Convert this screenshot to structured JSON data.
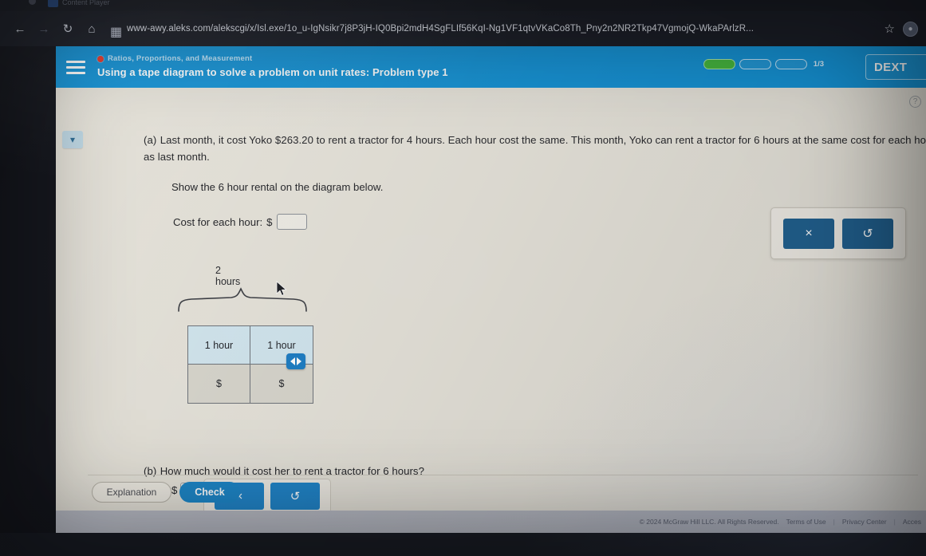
{
  "browser": {
    "tab_title": "Content Player",
    "url": "www-awy.aleks.com/alekscgi/x/Isl.exe/1o_u-IgNsikr7j8P3jH-IQ0Bpi2mdH4SgFLIf56KqI-Ng1VF1qtvVKaCo8Th_Pny2n2NR2Tkp47VgmojQ-WkaPArlzR...",
    "back_icon": "back-arrow-icon",
    "forward_icon": "forward-arrow-icon",
    "reload_icon": "reload-icon",
    "home_icon": "home-icon",
    "site_icon": "site-info-icon",
    "bookmark_icon": "star-icon",
    "profile_icon": "profile-avatar-icon"
  },
  "header": {
    "menu_icon": "hamburger-menu-icon",
    "eyebrow": "Ratios, Proportions, and Measurement",
    "title": "Using a tape diagram to solve a problem on unit rates: Problem type 1",
    "progress_segments": [
      true,
      false,
      false
    ],
    "progress_count": "1/3",
    "account_button": "DEXT",
    "accent_color": "#1593d6"
  },
  "content": {
    "collapse_icon": "chevron-down-icon",
    "help_icon": "question-mark-icon",
    "part_a": {
      "label": "(a)",
      "text": "Last month, it cost Yoko $263.20 to rent a tractor for 4 hours. Each hour cost the same. This month, Yoko can rent a tractor for 6 hours at the same cost for each hour as last month.",
      "instruction": "Show the 6 hour rental on the diagram below.",
      "cost_label": "Cost for each hour:",
      "currency": "$",
      "cost_value": "",
      "cost_placeholder": ""
    },
    "tape_diagram": {
      "brace_label": "2 hours",
      "hour_cells": [
        "1 hour",
        "1 hour"
      ],
      "money_cells": [
        "$",
        "$"
      ],
      "handle_icon": "drag-left-right-handle-icon",
      "hour_cell_color": "#d2e6ef",
      "money_cell_color": "#d8d6cd",
      "cursor_icon": "mouse-pointer-icon"
    },
    "tool_panel": {
      "clear_icon": "×",
      "undo_icon": "↺",
      "clear_name": "clear-button",
      "undo_name": "undo-button"
    },
    "part_b": {
      "label": "(b)",
      "text": "How much would it cost her to rent a tractor for 6 hours?",
      "currency": "$",
      "value": "",
      "clear_icon": "×",
      "undo_icon": "↺"
    },
    "buttons": {
      "explanation": "Explanation",
      "check": "Check"
    }
  },
  "footer": {
    "copyright": "© 2024 McGraw Hill LLC. All Rights Reserved.",
    "terms": "Terms of Use",
    "privacy": "Privacy Center",
    "accessibility": "Acces",
    "separator": "|"
  }
}
